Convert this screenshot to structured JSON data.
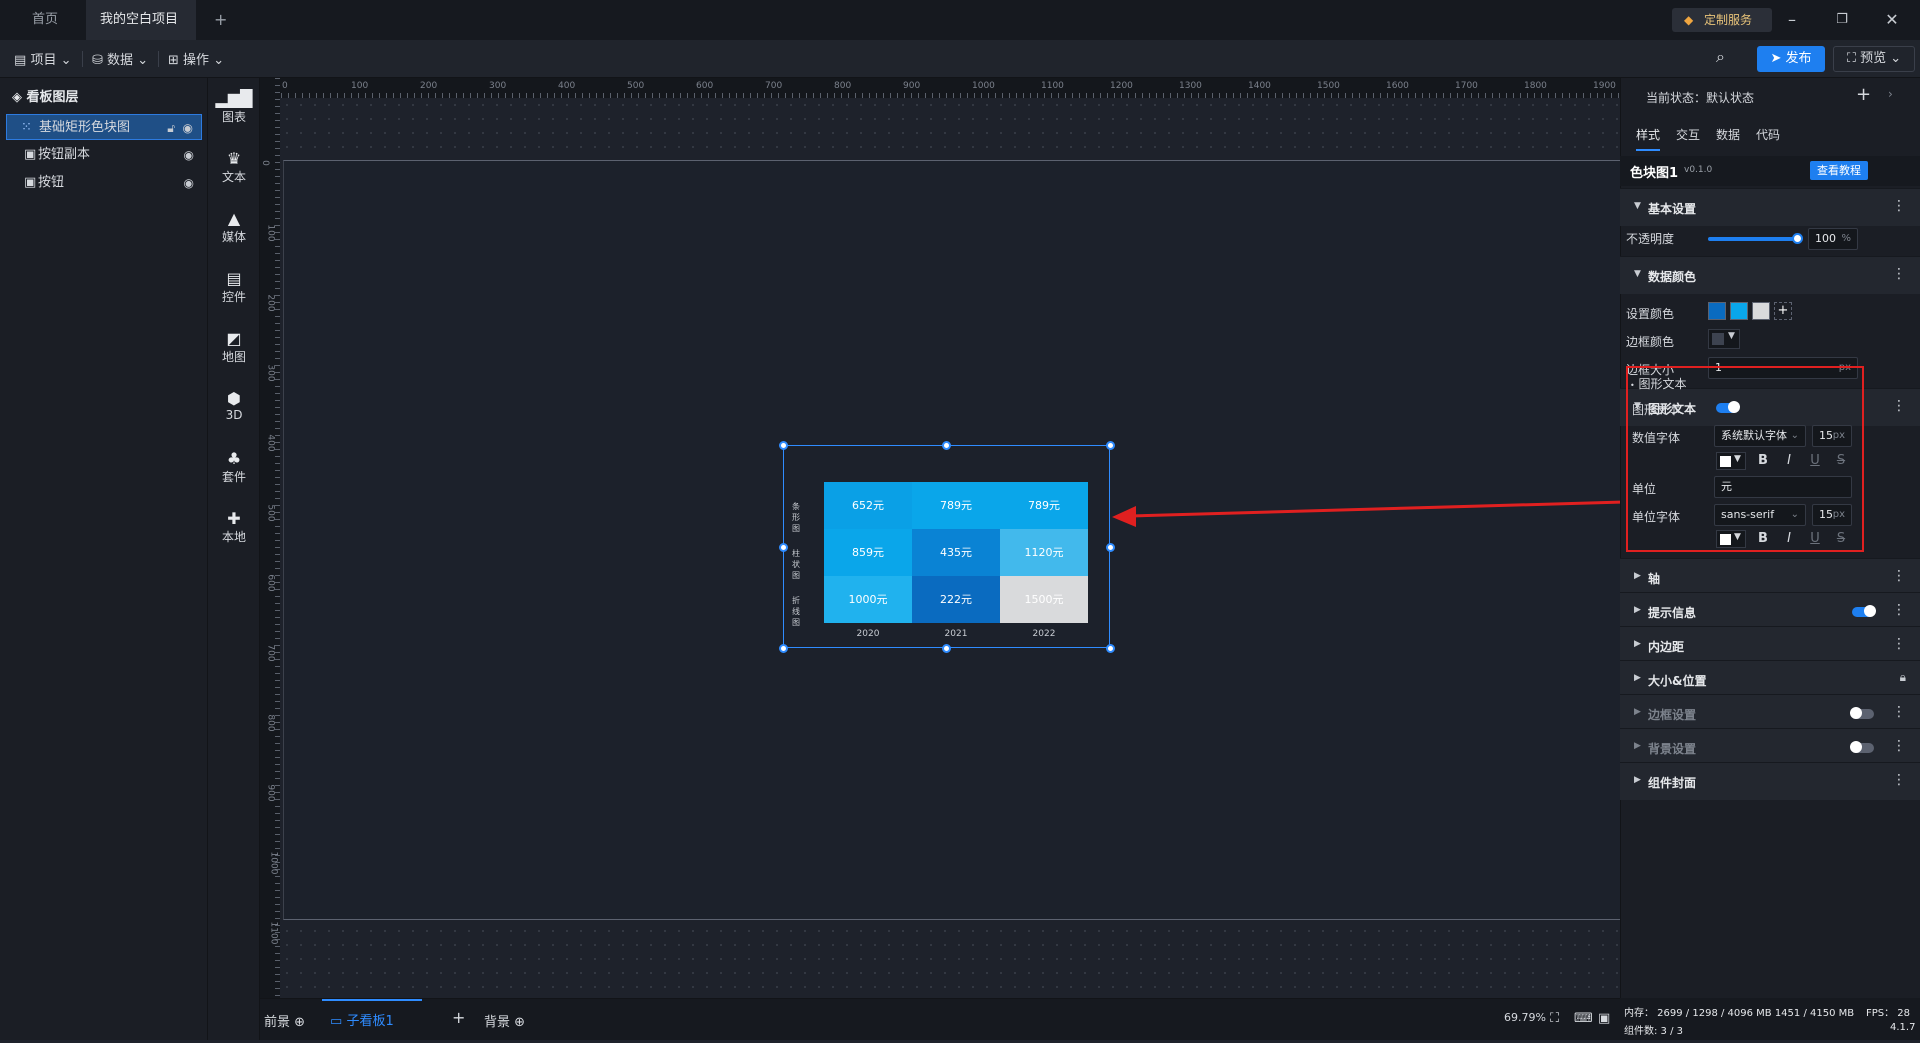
{
  "tabs": [
    {
      "label": "首页"
    },
    {
      "label": "我的空白项目"
    }
  ],
  "custom_service": "定制服务",
  "toolbar": {
    "project": "项目",
    "data": "数据",
    "operate": "操作",
    "publish": "发布",
    "preview": "预览"
  },
  "layers": {
    "title": "看板图层",
    "items": [
      {
        "label": "基础矩形色块图"
      },
      {
        "label": "按钮副本"
      },
      {
        "label": "按钮"
      }
    ]
  },
  "components": [
    {
      "label": "图表",
      "icon": "bar-chart-icon"
    },
    {
      "label": "文本",
      "icon": "text-icon"
    },
    {
      "label": "媒体",
      "icon": "media-icon"
    },
    {
      "label": "控件",
      "icon": "control-icon"
    },
    {
      "label": "地图",
      "icon": "map-icon"
    },
    {
      "label": "3D",
      "icon": "cube-icon"
    },
    {
      "label": "套件",
      "icon": "kit-icon"
    },
    {
      "label": "本地",
      "icon": "puzzle-icon"
    }
  ],
  "ruler_top_ticks": [
    "0",
    "100",
    "200",
    "300",
    "400",
    "500",
    "600",
    "700",
    "800",
    "900",
    "1000",
    "1100",
    "1200",
    "1300",
    "1400",
    "1500",
    "1600",
    "1700",
    "1800",
    "1900"
  ],
  "ruler_left_ticks": [
    "0",
    "100",
    "200",
    "300",
    "400",
    "500",
    "600",
    "700",
    "800",
    "900",
    "1000",
    "1100"
  ],
  "heatmap": {
    "rows": [
      "条形图",
      "柱状图",
      "折线图"
    ],
    "cols": [
      "2020",
      "2021",
      "2022"
    ],
    "cells": [
      [
        {
          "text": "652元",
          "color": "#0aa0e6"
        },
        {
          "text": "789元",
          "color": "#0aa6ea"
        },
        {
          "text": "789元",
          "color": "#0aa6ea"
        }
      ],
      [
        {
          "text": "859元",
          "color": "#0aa6ea"
        },
        {
          "text": "435元",
          "color": "#0a83d4"
        },
        {
          "text": "1120元",
          "color": "#42b9ec"
        }
      ],
      [
        {
          "text": "1000元",
          "color": "#20b2ee"
        },
        {
          "text": "222元",
          "color": "#0a6bc0"
        },
        {
          "text": "1500元",
          "color": "#d9dadc"
        }
      ]
    ]
  },
  "bottom": {
    "front": "前景",
    "subboard": "子看板1",
    "background": "背景",
    "zoom": "69.79%"
  },
  "rpanel": {
    "state_label": "当前状态：",
    "state_value": "默认状态",
    "tabs": [
      "样式",
      "交互",
      "数据",
      "代码"
    ],
    "component_name": "色块图1",
    "version": "v0.1.0",
    "tutorial": "查看教程",
    "basic": "基本设置",
    "opacity_label": "不透明度",
    "opacity_value": "100",
    "opacity_unit": "%",
    "data_color": "数据颜色",
    "set_color": "设置颜色",
    "border_color": "边框颜色",
    "border_size": "边框大小",
    "border_size_value": "1",
    "px": "px",
    "shape_text": "图形文本",
    "shape_text_sub": "图形文本",
    "shape_text_toggle": "图形文本",
    "value_font": "数值字体",
    "value_font_family": "系统默认字体",
    "value_font_size": "15",
    "unit_label": "单位",
    "unit_value": "元",
    "unit_font": "单位字体",
    "unit_font_family": "sans-serif",
    "unit_font_size": "15",
    "sections": [
      {
        "label": "轴"
      },
      {
        "label": "提示信息"
      },
      {
        "label": "内边距"
      },
      {
        "label": "大小&位置"
      },
      {
        "label": "边框设置"
      },
      {
        "label": "背景设置"
      },
      {
        "label": "组件封面"
      }
    ]
  },
  "status": {
    "memory": "内存： 2699 / 1298 / 4096 MB  1451 / 4150 MB",
    "fps": "FPS：  28",
    "count": "组件数: 3 / 3",
    "version": "4.1.7"
  },
  "colors": {
    "accent": "#1e7ff0",
    "highlight_box": "#e02020"
  }
}
